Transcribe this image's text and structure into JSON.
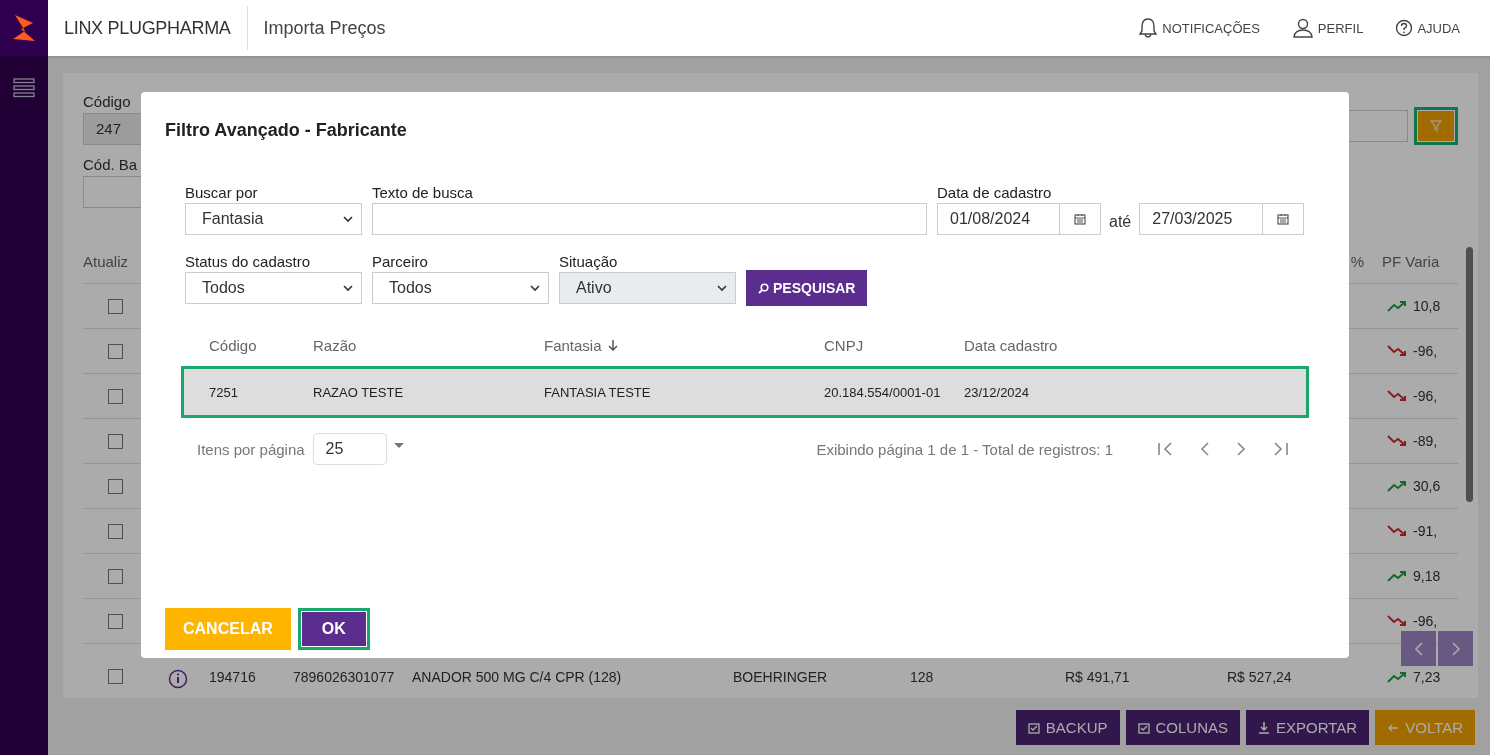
{
  "header": {
    "brand": "LINX PLUGPHARMA",
    "page_title": "Importa Preços",
    "actions": [
      {
        "kind": "notifications",
        "label": "NOTIFICAÇÕES"
      },
      {
        "kind": "profile",
        "label": "PERFIL"
      },
      {
        "kind": "help",
        "label": "AJUDA"
      }
    ]
  },
  "background": {
    "code_label": "Código",
    "code_value": "247",
    "barcode_label": "Cód. Ba",
    "filter_button": {
      "focused": true
    },
    "columns": {
      "first": "Atualiz",
      "percent": "%",
      "last": "PF Varia"
    },
    "rows": [
      {
        "checked": false,
        "kind": "up",
        "value": "10,8"
      },
      {
        "checked": false,
        "kind": "down",
        "value": "-96,"
      },
      {
        "checked": false,
        "kind": "down",
        "value": "-96,"
      },
      {
        "checked": false,
        "kind": "down",
        "value": "-89,"
      },
      {
        "checked": false,
        "kind": "up",
        "value": "30,6"
      },
      {
        "checked": false,
        "kind": "down",
        "value": "-91,"
      },
      {
        "checked": false,
        "kind": "up",
        "value": "9,18"
      },
      {
        "checked": false,
        "kind": "down",
        "value": "-96,"
      }
    ],
    "last_row": {
      "checked": false,
      "kind": "up",
      "cells": [
        "194716",
        "7896026301077",
        "ANADOR 500 MG C/4 CPR (128)",
        "BOEHRINGER",
        "128",
        "R$ 491,71",
        "R$ 527,24"
      ],
      "value": "7,23"
    },
    "bottom_buttons": [
      {
        "label": "BACKUP",
        "kind": "checkbox"
      },
      {
        "label": "COLUNAS",
        "kind": "checkbox"
      },
      {
        "label": "EXPORTAR",
        "kind": "download"
      },
      {
        "label": "VOLTAR",
        "kind": "back"
      }
    ]
  },
  "modal": {
    "title": "Filtro Avançado - Fabricante",
    "search_by": {
      "label": "Buscar por",
      "value": "Fantasia"
    },
    "search_text": {
      "label": "Texto de busca"
    },
    "date": {
      "label": "Data de cadastro",
      "from": "01/08/2024",
      "separator": "até",
      "to": "27/03/2025"
    },
    "selects": [
      {
        "label": "Status do cadastro",
        "value": "Todos",
        "disabled": false
      },
      {
        "label": "Parceiro",
        "value": "Todos",
        "disabled": false
      },
      {
        "label": "Situação",
        "value": "Ativo",
        "disabled": true
      }
    ],
    "search_button": "PESQUISAR",
    "table": {
      "columns": [
        {
          "label": "Código",
          "sorted": false
        },
        {
          "label": "Razão",
          "sorted": false
        },
        {
          "label": "Fantasia",
          "sorted": true
        },
        {
          "label": "CNPJ",
          "sorted": false
        },
        {
          "label": "Data cadastro",
          "sorted": false
        }
      ],
      "rows": [
        {
          "selected": true,
          "cells": [
            "7251",
            "RAZAO TESTE",
            "FANTASIA TESTE",
            "20.184.554/0001-01",
            "23/12/2024"
          ]
        }
      ]
    },
    "page_size_label": "Itens por página",
    "page_size": "25",
    "page_info": "Exibindo página 1 de 1 - Total de registros: 1",
    "buttons": [
      {
        "label": "CANCELAR",
        "kind": "warning",
        "focused": false
      },
      {
        "label": "OK",
        "kind": "primary",
        "focused": true
      }
    ]
  }
}
